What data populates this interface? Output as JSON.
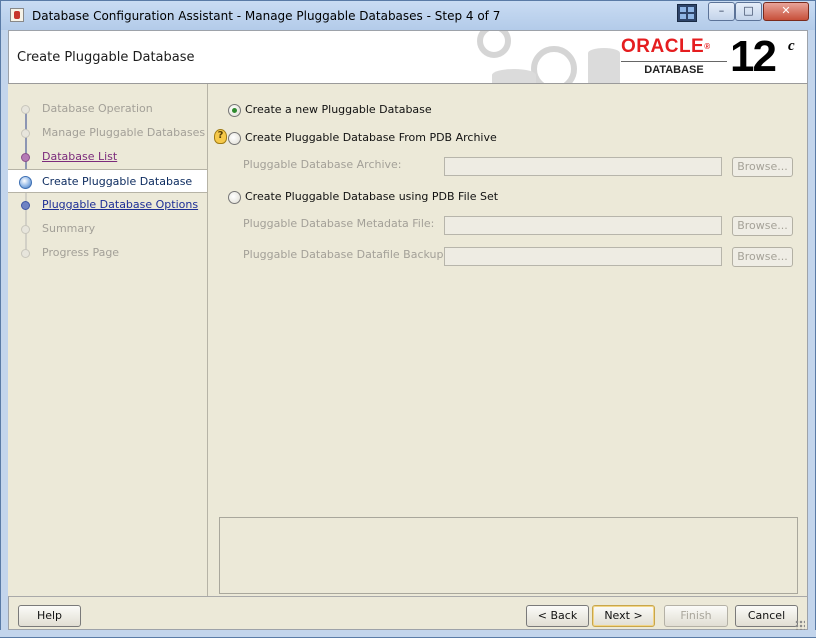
{
  "window": {
    "title": "Database Configuration Assistant - Manage Pluggable Databases - Step 4 of 7",
    "minimize_glyph": "–",
    "maximize_glyph": "□",
    "close_glyph": "✕"
  },
  "header": {
    "page_title": "Create Pluggable Database",
    "logo_word": "ORACLE",
    "logo_registered": "®",
    "logo_sub": "DATABASE",
    "version": "12",
    "version_sup": "c"
  },
  "steps": [
    {
      "label": "Database Operation",
      "state": "disabled"
    },
    {
      "label": "Manage Pluggable Databases",
      "state": "disabled"
    },
    {
      "label": "Database List",
      "state": "visited"
    },
    {
      "label": "Create Pluggable Database",
      "state": "current"
    },
    {
      "label": "Pluggable Database Options",
      "state": "link"
    },
    {
      "label": "Summary",
      "state": "disabled"
    },
    {
      "label": "Progress Page",
      "state": "disabled"
    }
  ],
  "options": {
    "new_pdb": {
      "label": "Create a new Pluggable Database",
      "checked": true
    },
    "from_archive": {
      "label": "Create Pluggable Database From PDB Archive",
      "checked": false
    },
    "from_fileset": {
      "label": "Create Pluggable Database using PDB File Set",
      "checked": false
    }
  },
  "fields": {
    "archive": {
      "label": "Pluggable Database Archive:",
      "value": ""
    },
    "metadata_file": {
      "label": "Pluggable Database Metadata File:",
      "value": ""
    },
    "datafile_backup": {
      "label": "Pluggable Database Datafile Backup:",
      "value": ""
    }
  },
  "hint_glyph": "?",
  "browse_label": "Browse...",
  "buttons": {
    "help": "Help",
    "back": "< Back",
    "next": "Next >",
    "finish": "Finish",
    "cancel": "Cancel"
  },
  "colors": {
    "oracle_red": "#e51d1f",
    "panel_bg": "#ece9d8",
    "link_blue": "#1d2e96",
    "visited_purple": "#7b2a7b"
  }
}
